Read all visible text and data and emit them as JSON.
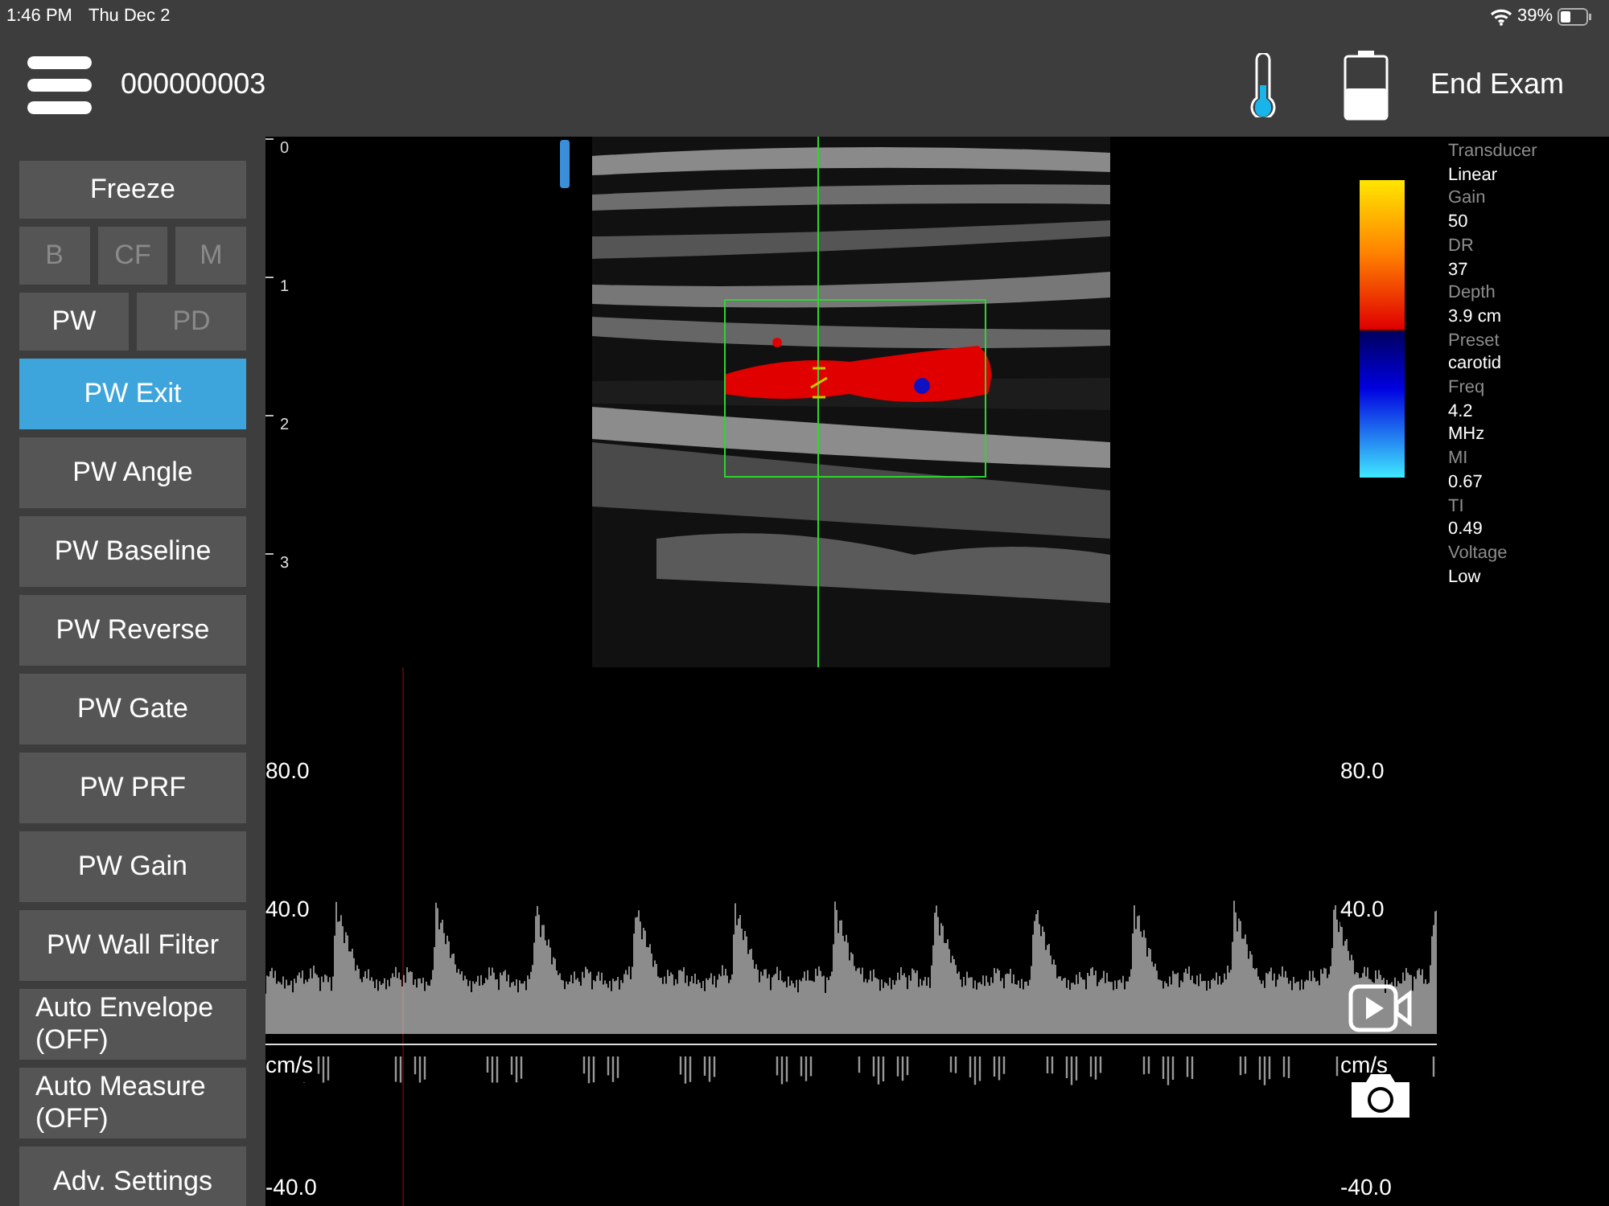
{
  "status_bar": {
    "time": "1:46 PM",
    "date": "Thu Dec 2",
    "battery": "39%"
  },
  "header": {
    "exam_id": "000000003",
    "end_button": "End Exam"
  },
  "sidebar": {
    "freeze": {
      "label": "Freeze",
      "selected": false,
      "disabled": false
    },
    "imaging_modes": [
      {
        "label": "B",
        "selected": false,
        "disabled": true
      },
      {
        "label": "CF",
        "selected": false,
        "disabled": true
      },
      {
        "label": "M",
        "selected": false,
        "disabled": true
      }
    ],
    "doppler_modes": [
      {
        "label": "PW",
        "selected": false,
        "disabled": false
      },
      {
        "label": "PD",
        "selected": false,
        "disabled": true
      }
    ],
    "buttons": [
      [
        {
          "label": "PW Exit",
          "selected": true,
          "disabled": false
        }
      ],
      [
        {
          "label": "PW Angle",
          "selected": false,
          "disabled": false
        }
      ],
      [
        {
          "label": "PW Baseline",
          "selected": false,
          "disabled": false
        }
      ],
      [
        {
          "label": "PW Reverse",
          "selected": false,
          "disabled": false
        }
      ],
      [
        {
          "label": "PW Gate",
          "selected": false,
          "disabled": false
        }
      ],
      [
        {
          "label": "PW PRF",
          "selected": false,
          "disabled": false
        }
      ],
      [
        {
          "label": "PW Gain",
          "selected": false,
          "disabled": false
        }
      ],
      [
        {
          "label": "PW Wall Filter",
          "selected": false,
          "disabled": false
        }
      ],
      [
        {
          "label": "Auto Envelope (OFF)",
          "selected": false,
          "disabled": false
        }
      ],
      [
        {
          "label": "Auto Measure (OFF)",
          "selected": false,
          "disabled": false
        }
      ],
      [
        {
          "label": "Adv. Settings",
          "selected": false,
          "disabled": false
        }
      ]
    ]
  },
  "depth_scale": [
    "0",
    "1",
    "2",
    "3"
  ],
  "parameters": [
    {
      "label": "Transducer",
      "lines": [
        "Linear"
      ]
    },
    {
      "label": "Gain",
      "lines": [
        "50"
      ]
    },
    {
      "label": "DR",
      "lines": [
        "37"
      ]
    },
    {
      "label": "Depth",
      "lines": [
        "3.9 cm"
      ]
    },
    {
      "label": "Preset",
      "lines": [
        "carotid"
      ]
    },
    {
      "label": "Freq",
      "lines": [
        "4.2",
        "MHz"
      ]
    },
    {
      "label": "MI",
      "lines": [
        "0.67"
      ]
    },
    {
      "label": "TI",
      "lines": [
        "0.49"
      ]
    },
    {
      "label": "Voltage",
      "lines": [
        "Low"
      ]
    }
  ],
  "spectrum": {
    "left_scale": [
      "80.0",
      "40.0",
      "cm/s",
      "-40.0"
    ],
    "right_scale": [
      "80.0",
      "40.0",
      "cm/s",
      "-40.0"
    ]
  }
}
